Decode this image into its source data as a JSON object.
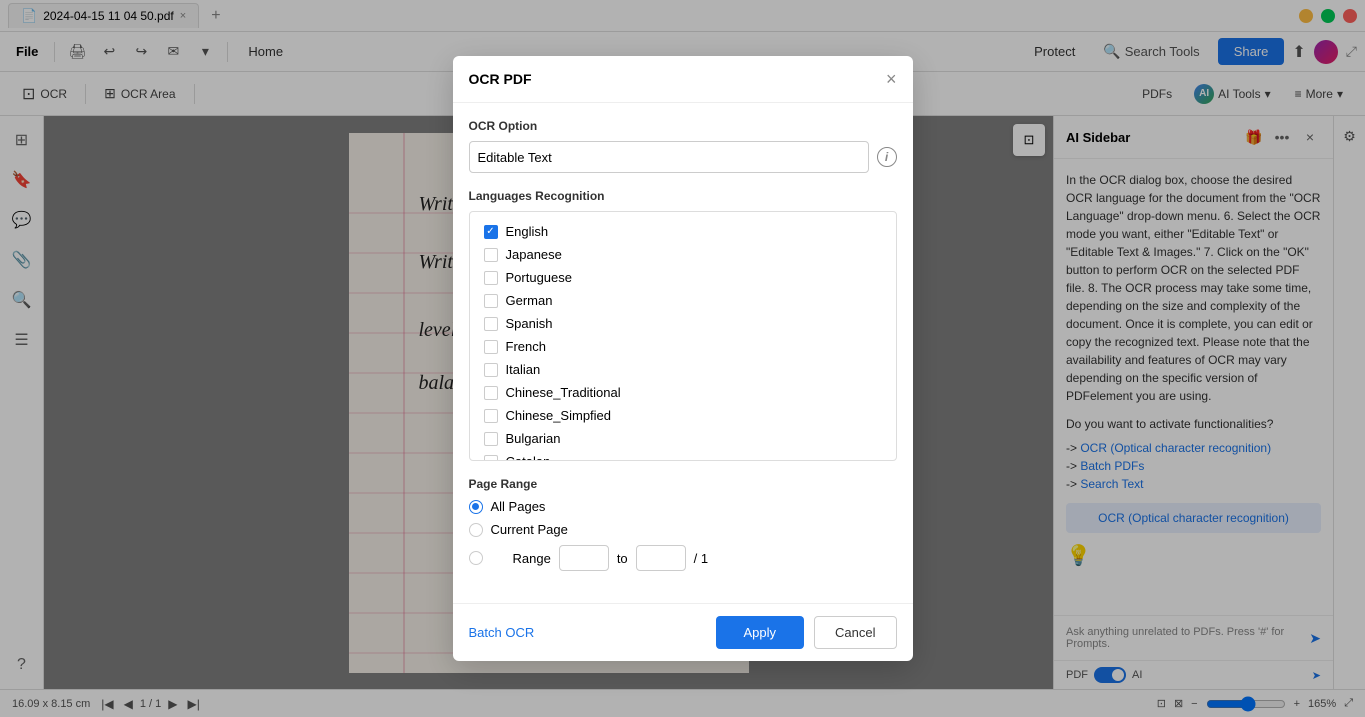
{
  "window": {
    "tab_title": "2024-04-15 11 04 50.pdf",
    "close_label": "×",
    "add_tab_label": "+"
  },
  "win_controls": {
    "min": "–",
    "max": "□",
    "close": "×"
  },
  "toolbar": {
    "file_label": "File",
    "home_label": "Home",
    "protect_label": "Protect",
    "search_tools_label": "Search Tools",
    "share_label": "Share",
    "more_label": "More"
  },
  "toolbar2": {
    "ocr_label": "OCR",
    "ocr_area_label": "OCR Area",
    "pdfs_label": "PDFs",
    "ai_tools_label": "AI Tools",
    "ai_letter": "AI",
    "more_label": "More"
  },
  "ocr_dialog": {
    "title": "OCR PDF",
    "ocr_option_label": "OCR Option",
    "ocr_option_value": "Editable Text",
    "info_icon": "i",
    "languages_label": "Languages Recognition",
    "languages": [
      {
        "name": "English",
        "checked": true
      },
      {
        "name": "Japanese",
        "checked": false
      },
      {
        "name": "Portuguese",
        "checked": false
      },
      {
        "name": "German",
        "checked": false
      },
      {
        "name": "Spanish",
        "checked": false
      },
      {
        "name": "French",
        "checked": false
      },
      {
        "name": "Italian",
        "checked": false
      },
      {
        "name": "Chinese_Traditional",
        "checked": false
      },
      {
        "name": "Chinese_Simpfied",
        "checked": false
      },
      {
        "name": "Bulgarian",
        "checked": false
      },
      {
        "name": "Catalan",
        "checked": false
      }
    ],
    "page_range_label": "Page Range",
    "all_pages_label": "All Pages",
    "current_page_label": "Current Page",
    "range_label": "Range",
    "range_to": "to",
    "range_total": "/ 1",
    "batch_ocr_label": "Batch OCR",
    "apply_label": "Apply",
    "cancel_label": "Cancel"
  },
  "ai_sidebar": {
    "title": "AI Sidebar",
    "description": "In the OCR dialog box, choose the desired OCR language for the document from the \"OCR Language\" drop-down menu. 6. Select the OCR mode you want, either \"Editable Text\" or \"Editable Text & Images.\" 7. Click on the \"OK\" button to perform OCR on the selected PDF file. 8. The OCR process may take some time, depending on the size and complexity of the document. Once it is complete, you can edit or copy the recognized text. Please note that the availability and features of OCR may vary depending on the specific version of PDFelement you are using.",
    "activate_label": "Do you want to activate functionalities?",
    "ocr_link": "OCR (Optical character recognition)",
    "batch_pdfs_link": "Batch PDFs",
    "search_text_link": "Search Text",
    "ocr_button_label": "OCR (Optical character recognition)",
    "input_placeholder": "Ask anything unrelated to PDFs. Press '#' for Prompts.",
    "pdf_label": "PDF",
    "ai_label": "AI",
    "arrow_label": "→"
  },
  "pdf_content": {
    "line1": "Writing slopes upward",
    "line2": "Writing slopes downward",
    "line3": "leveled writing means",
    "line4": "balanced person."
  },
  "status_bar": {
    "dimensions": "16.09 x 8.15 cm",
    "page_info": "1 / 1",
    "zoom_level": "165%"
  }
}
